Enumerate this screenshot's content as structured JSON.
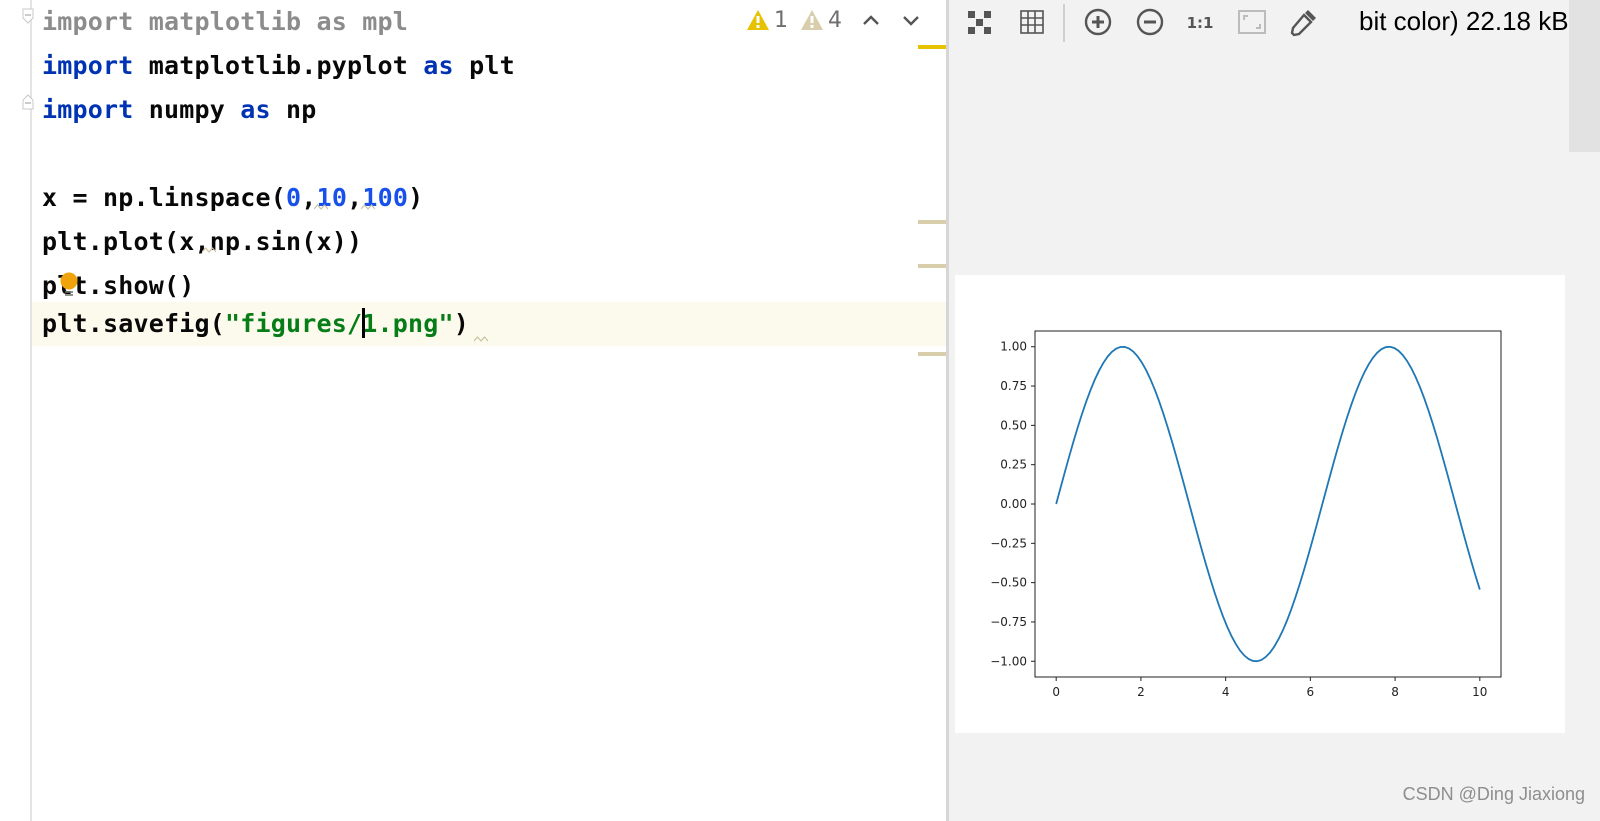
{
  "editor": {
    "lines": [
      {
        "parts": [
          {
            "t": "import",
            "c": "dim"
          },
          {
            "t": " matplotlib ",
            "c": "dim"
          },
          {
            "t": "as",
            "c": "dim"
          },
          {
            "t": " mpl",
            "c": "dim"
          }
        ]
      },
      {
        "parts": [
          {
            "t": "import",
            "c": "kw"
          },
          {
            "t": " matplotlib.pyplot ",
            "c": ""
          },
          {
            "t": "as",
            "c": "kw"
          },
          {
            "t": " plt",
            "c": ""
          }
        ]
      },
      {
        "parts": [
          {
            "t": "import",
            "c": "kw"
          },
          {
            "t": " numpy ",
            "c": ""
          },
          {
            "t": "as",
            "c": "kw"
          },
          {
            "t": " np",
            "c": ""
          }
        ]
      },
      {
        "parts": []
      },
      {
        "parts": [
          {
            "t": "x = np.linspace(",
            "c": ""
          },
          {
            "t": "0",
            "c": "num"
          },
          {
            "t": ",",
            "c": ""
          },
          {
            "t": "10",
            "c": "num"
          },
          {
            "t": ",",
            "c": ""
          },
          {
            "t": "100",
            "c": "num"
          },
          {
            "t": ")",
            "c": ""
          }
        ]
      },
      {
        "parts": [
          {
            "t": "plt.plot(x,np.sin(x))",
            "c": ""
          }
        ]
      },
      {
        "parts": [
          {
            "t": "plt.show()",
            "c": ""
          }
        ]
      },
      {
        "parts": [
          {
            "t": "plt.savefig(",
            "c": ""
          },
          {
            "t": "\"figures/",
            "c": "str"
          },
          {
            "t": "|",
            "c": "caret"
          },
          {
            "t": "1.png\"",
            "c": "str"
          },
          {
            "t": ")",
            "c": ""
          }
        ]
      }
    ],
    "inspections": {
      "warnings_count": "1",
      "weak_warnings_count": "4",
      "warning_color": "#e6c200",
      "weak_warning_color": "#d9ceab"
    }
  },
  "viewer": {
    "info_text": "bit color) 22.18 kB",
    "tools": [
      {
        "name": "chessboard-icon",
        "label": "Show chessboard"
      },
      {
        "name": "grid-icon",
        "label": "Show grid"
      },
      {
        "name": "zoom-in-icon",
        "label": "Zoom in"
      },
      {
        "name": "zoom-out-icon",
        "label": "Zoom out"
      },
      {
        "name": "actual-size-icon",
        "label": "1:1"
      },
      {
        "name": "fit-zoom-icon",
        "label": "Fit zoom to window"
      },
      {
        "name": "color-picker-icon",
        "label": "Color picker"
      }
    ]
  },
  "chart_data": {
    "type": "line",
    "title": "",
    "xlabel": "",
    "ylabel": "",
    "xlim": [
      -0.5,
      10.5
    ],
    "ylim": [
      -1.1,
      1.1
    ],
    "xticks": [
      0,
      2,
      4,
      6,
      8,
      10
    ],
    "xtick_labels": [
      "0",
      "2",
      "4",
      "6",
      "8",
      "10"
    ],
    "yticks": [
      -1.0,
      -0.75,
      -0.5,
      -0.25,
      0.0,
      0.25,
      0.5,
      0.75,
      1.0
    ],
    "ytick_labels": [
      "−1.00",
      "−0.75",
      "−0.50",
      "−0.25",
      "0.00",
      "0.25",
      "0.50",
      "0.75",
      "1.00"
    ],
    "grid": false,
    "series": [
      {
        "name": "sin(x)",
        "color": "#1f77b4",
        "function": "sin",
        "x_start": 0,
        "x_end": 10,
        "num_points": 100
      }
    ]
  },
  "watermark": "CSDN @Ding Jiaxiong"
}
